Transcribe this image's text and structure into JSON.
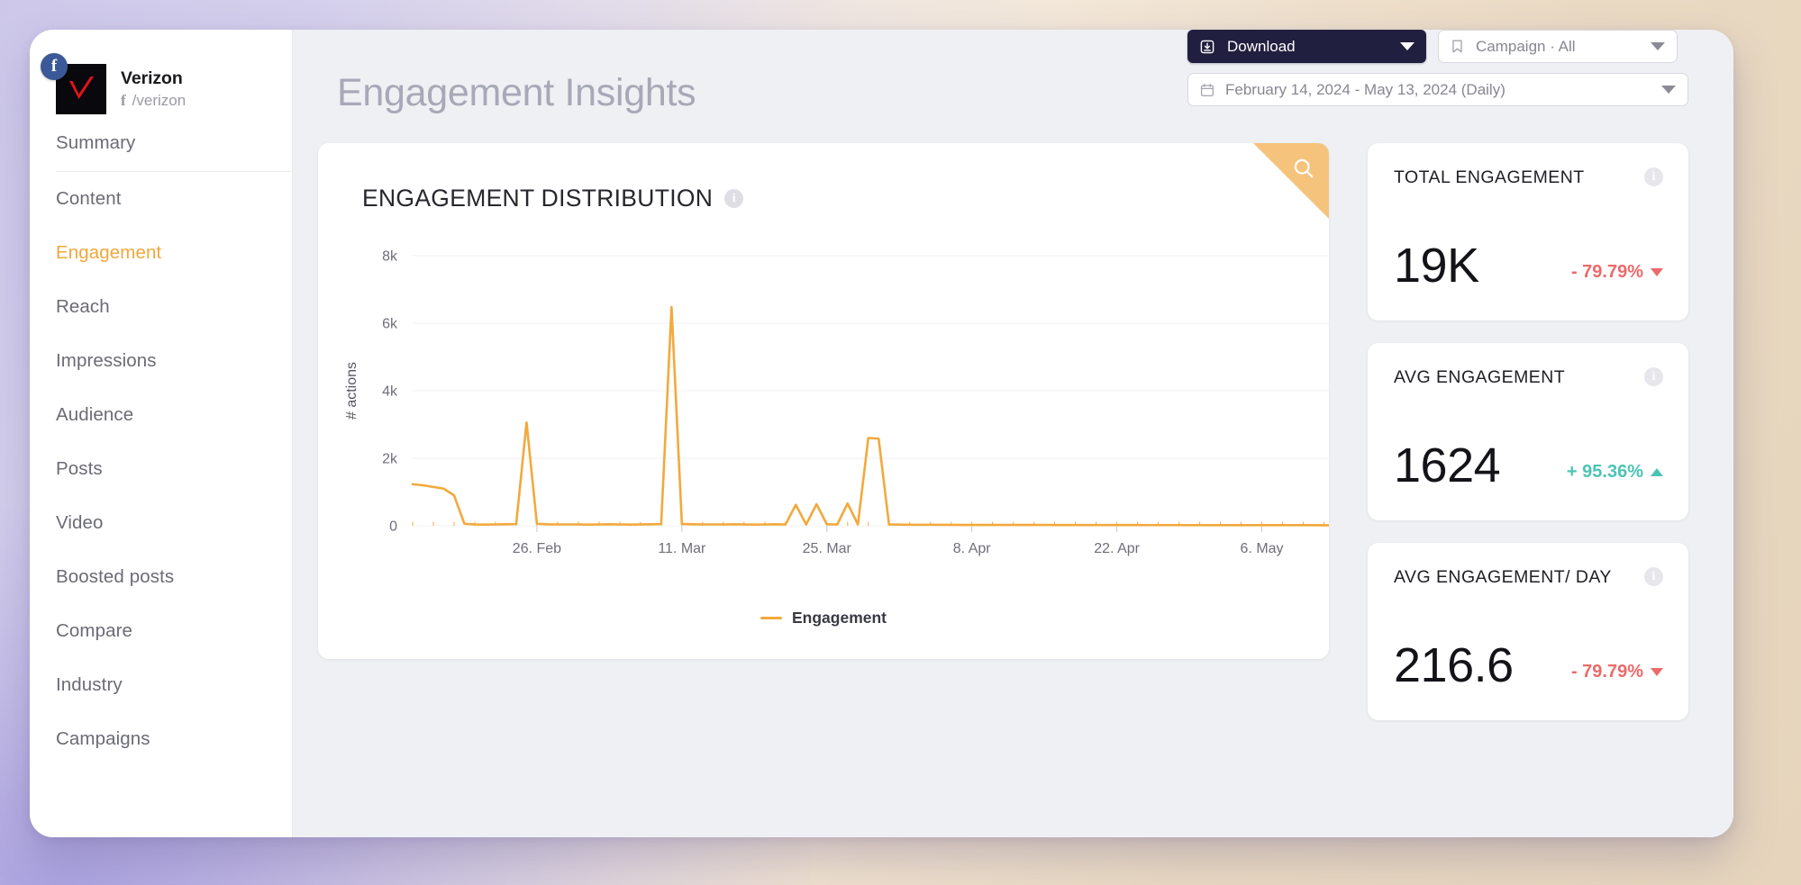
{
  "brand": {
    "name": "Verizon",
    "handle": "/verizon",
    "network_badge": "facebook-icon",
    "avatar_alt": "verizon-checkmark-logo"
  },
  "sidebar": {
    "items": [
      {
        "label": "Summary",
        "active": false
      },
      {
        "label": "Content",
        "active": false
      },
      {
        "label": "Engagement",
        "active": true
      },
      {
        "label": "Reach",
        "active": false
      },
      {
        "label": "Impressions",
        "active": false
      },
      {
        "label": "Audience",
        "active": false
      },
      {
        "label": "Posts",
        "active": false
      },
      {
        "label": "Video",
        "active": false
      },
      {
        "label": "Boosted posts",
        "active": false
      },
      {
        "label": "Compare",
        "active": false
      },
      {
        "label": "Industry",
        "active": false
      },
      {
        "label": "Campaigns",
        "active": false
      }
    ]
  },
  "header": {
    "title": "Engagement Insights",
    "download_label": "Download",
    "campaign_filter": "Campaign · All",
    "date_range": "February 14, 2024 - May 13, 2024 (Daily)"
  },
  "chart_card": {
    "title": "ENGAGEMENT DISTRIBUTION",
    "info_glyph": "i",
    "search_icon": "search-icon"
  },
  "kpis": [
    {
      "label": "TOTAL ENGAGEMENT",
      "value": "19K",
      "delta": "- 79.79%",
      "direction": "down",
      "color": "#ec6a6a"
    },
    {
      "label": "AVG ENGAGEMENT",
      "value": "1624",
      "delta": "+ 95.36%",
      "direction": "up",
      "color": "#4cc4b4"
    },
    {
      "label": "AVG ENGAGEMENT/ DAY",
      "value": "216.6",
      "delta": "- 79.79%",
      "direction": "down",
      "color": "#ec6a6a"
    }
  ],
  "colors": {
    "accent": "#f3a93c",
    "sidebar_active": "#f0a73c",
    "download_bg": "#211f3f",
    "positive": "#4cc4b4",
    "negative": "#ec6a6a",
    "corner_triangle": "#f6c37c"
  },
  "chart_data": {
    "type": "line",
    "title": "ENGAGEMENT DISTRIBUTION",
    "xlabel": "",
    "ylabel": "# actions",
    "ylim": [
      0,
      8000
    ],
    "yticks": [
      0,
      2000,
      4000,
      6000,
      8000
    ],
    "ytick_labels": [
      "0",
      "2k",
      "4k",
      "6k",
      "8k"
    ],
    "grid": true,
    "legend": [
      {
        "name": "Engagement",
        "color": "#f3a93c"
      }
    ],
    "legend_position": "bottom-center",
    "x_tick_positions": [
      12,
      26,
      40,
      54,
      68,
      82
    ],
    "x_tick_labels": [
      "26. Feb",
      "11. Mar",
      "25. Mar",
      "8. Apr",
      "22. Apr",
      "6. May"
    ],
    "x_count": 90,
    "series": [
      {
        "name": "Engagement",
        "color": "#f3a93c",
        "values": [
          1230,
          1200,
          1150,
          1100,
          900,
          60,
          40,
          35,
          40,
          45,
          50,
          3060,
          60,
          45,
          40,
          40,
          40,
          35,
          40,
          45,
          40,
          35,
          40,
          45,
          50,
          6480,
          55,
          45,
          40,
          40,
          40,
          45,
          40,
          35,
          40,
          45,
          40,
          620,
          40,
          640,
          45,
          40,
          660,
          40,
          2600,
          2580,
          40,
          35,
          30,
          30,
          30,
          28,
          28,
          26,
          26,
          26,
          25,
          25,
          25,
          24,
          24,
          24,
          23,
          23,
          23,
          22,
          22,
          22,
          21,
          21,
          21,
          20,
          20,
          20,
          20,
          19,
          19,
          19,
          19,
          18,
          18,
          18,
          18,
          18,
          17,
          17,
          17,
          17,
          16,
          16
        ]
      }
    ]
  }
}
